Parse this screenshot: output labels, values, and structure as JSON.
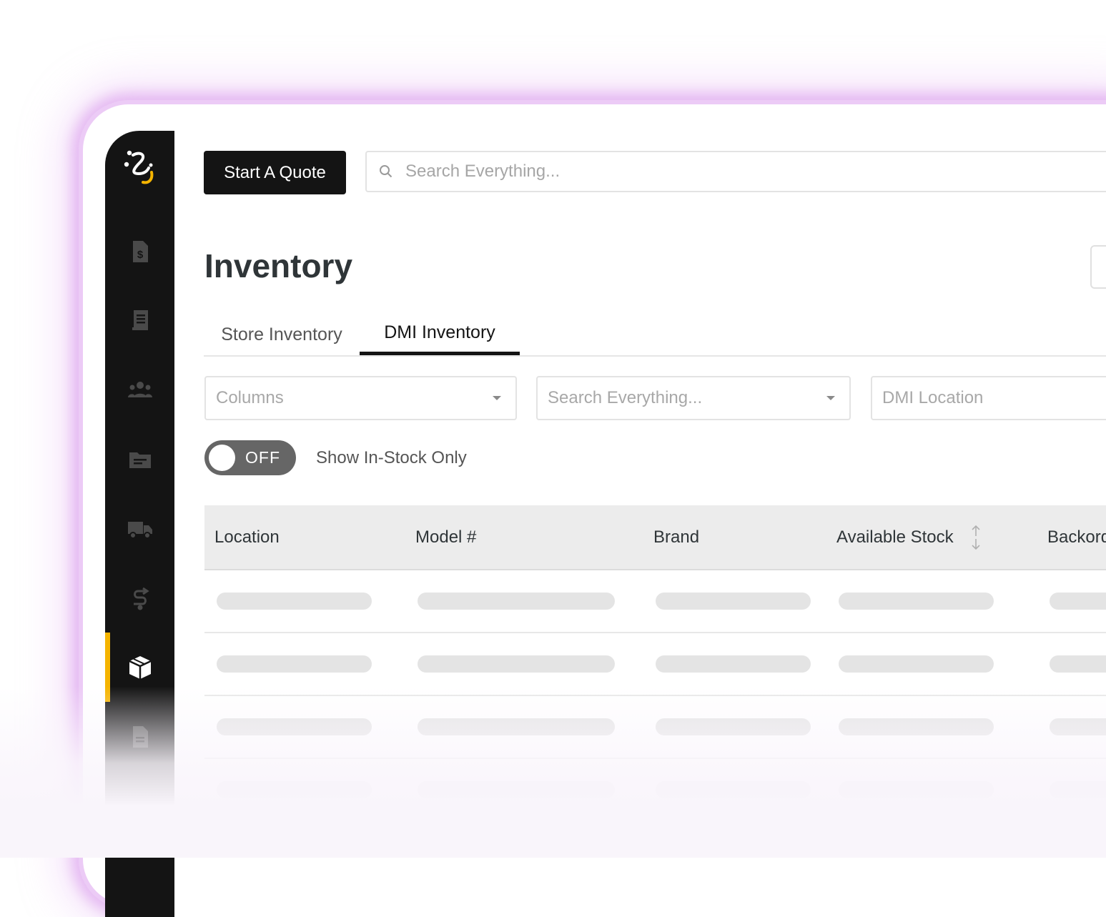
{
  "actions": {
    "start_quote_label": "Start A Quote"
  },
  "search": {
    "placeholder": "Search Everything..."
  },
  "page": {
    "title": "Inventory"
  },
  "tabs": [
    {
      "label": "Store Inventory",
      "active": false
    },
    {
      "label": "DMI Inventory",
      "active": true
    }
  ],
  "filters": {
    "columns_placeholder": "Columns",
    "search_placeholder": "Search Everything...",
    "location_placeholder": "DMI Location"
  },
  "toggle": {
    "state_label": "OFF",
    "label": "Show In-Stock Only"
  },
  "table": {
    "columns": [
      "Location",
      "Model #",
      "Brand",
      "Available Stock",
      "Backorder"
    ],
    "loading_rows": 4
  },
  "sidebar": {
    "icons": [
      "logo-icon",
      "invoice-dollar-icon",
      "receipt-icon",
      "users-icon",
      "folder-icon",
      "truck-icon",
      "route-icon",
      "package-icon",
      "document-icon"
    ],
    "active": "package-icon"
  },
  "colors": {
    "accent": "#f5b400",
    "sidebar_bg": "#141414",
    "glow": "#d896eb"
  }
}
